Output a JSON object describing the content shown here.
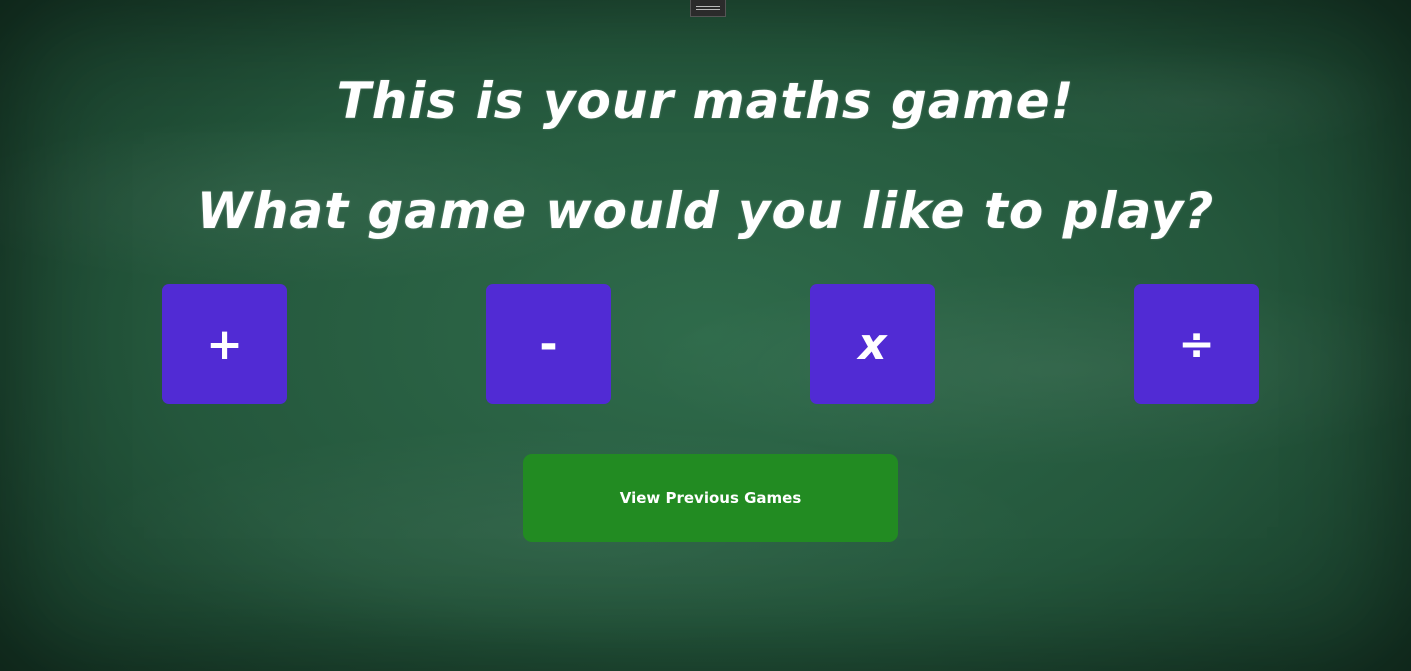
{
  "header": {
    "title": "This is your maths game!",
    "subtitle": "What game would you like to play?"
  },
  "operations": [
    {
      "label": "+",
      "name": "addition"
    },
    {
      "label": "-",
      "name": "subtraction"
    },
    {
      "label": "x",
      "name": "multiplication"
    },
    {
      "label": "÷",
      "name": "division"
    }
  ],
  "history_button": {
    "label": "View Previous Games"
  },
  "colors": {
    "operation_button": "#512bd4",
    "history_button": "#228b22",
    "chalkboard": "#2f6b4b",
    "text": "#ffffff"
  }
}
